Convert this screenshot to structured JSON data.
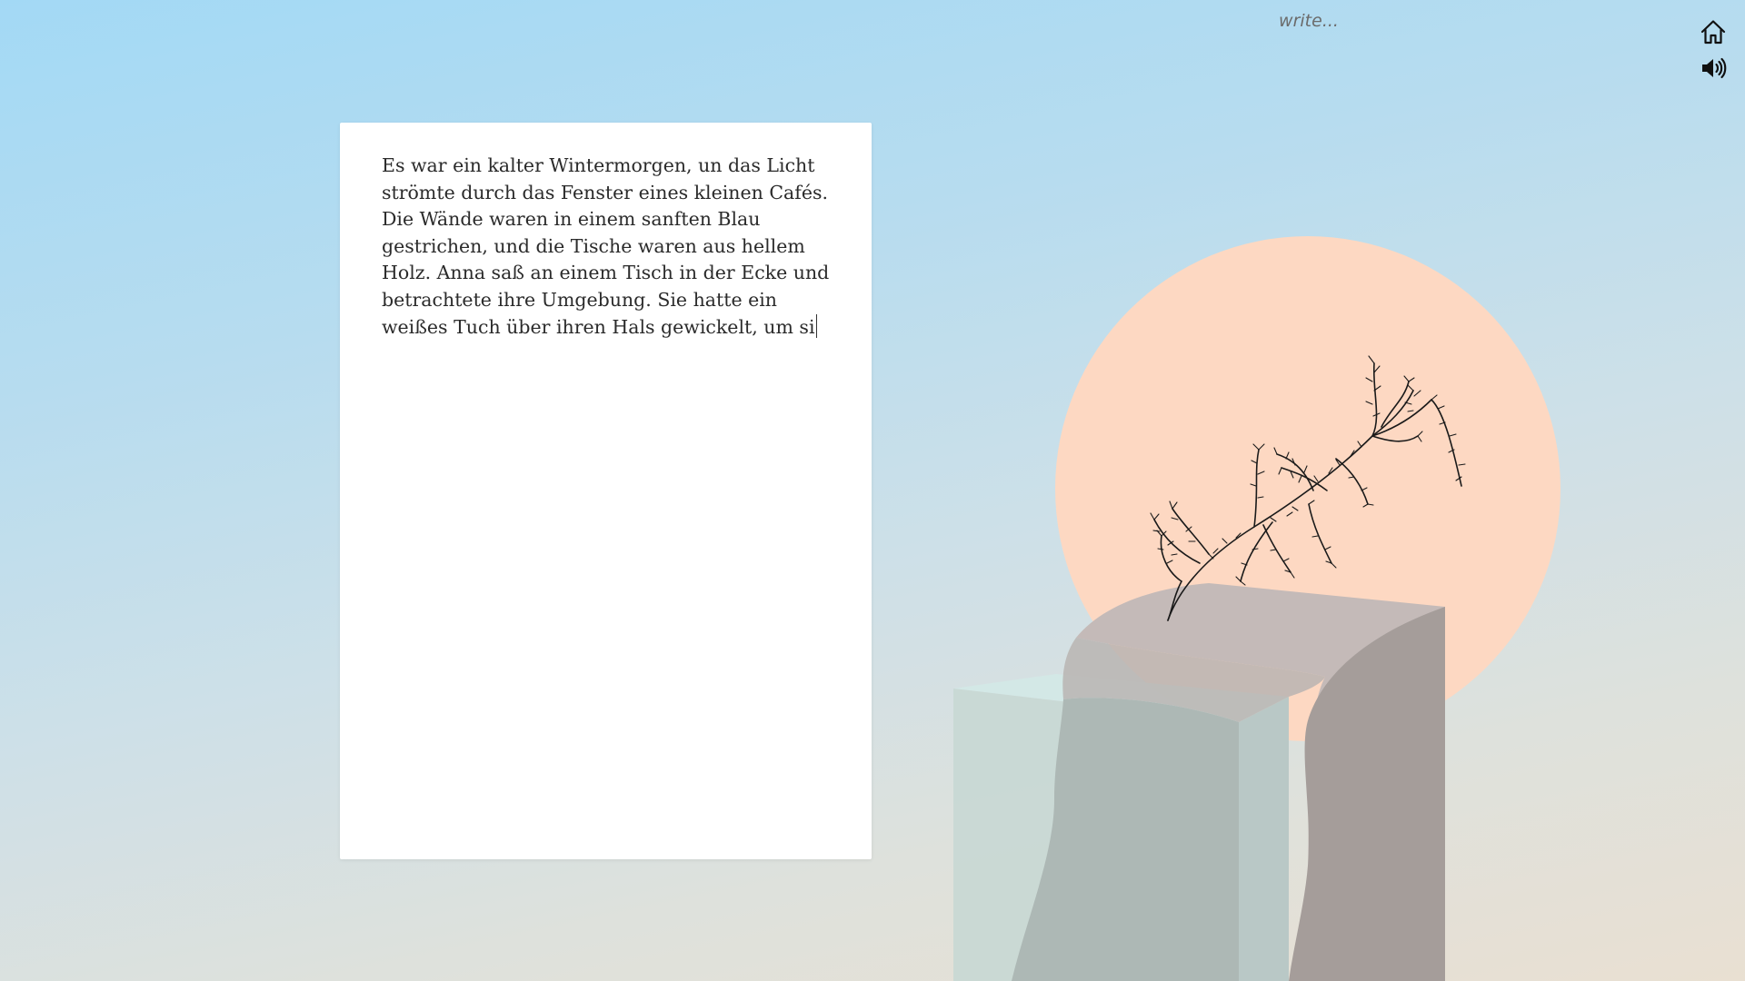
{
  "header": {
    "mode_label": "write..."
  },
  "controls": {
    "home_icon": "home-icon",
    "sound_icon": "speaker-icon"
  },
  "editor": {
    "text": "Es war ein kalter Wintermorgen, un das Licht strömte durch das Fenster eines kleinen Cafés. Die Wände waren in einem sanften Blau gestrichen, und die Tische waren aus hellem Holz. Anna saß an einem Tisch in der Ecke und betrachtete ihre Umgebung. Sie hatte ein weißes Tuch über ihren Hals gewickelt, um si"
  },
  "colors": {
    "sky_top": "#a3d9f5",
    "sky_bottom": "#e9e0d2",
    "sun": "#fdd8c2",
    "paper": "#ffffff"
  }
}
